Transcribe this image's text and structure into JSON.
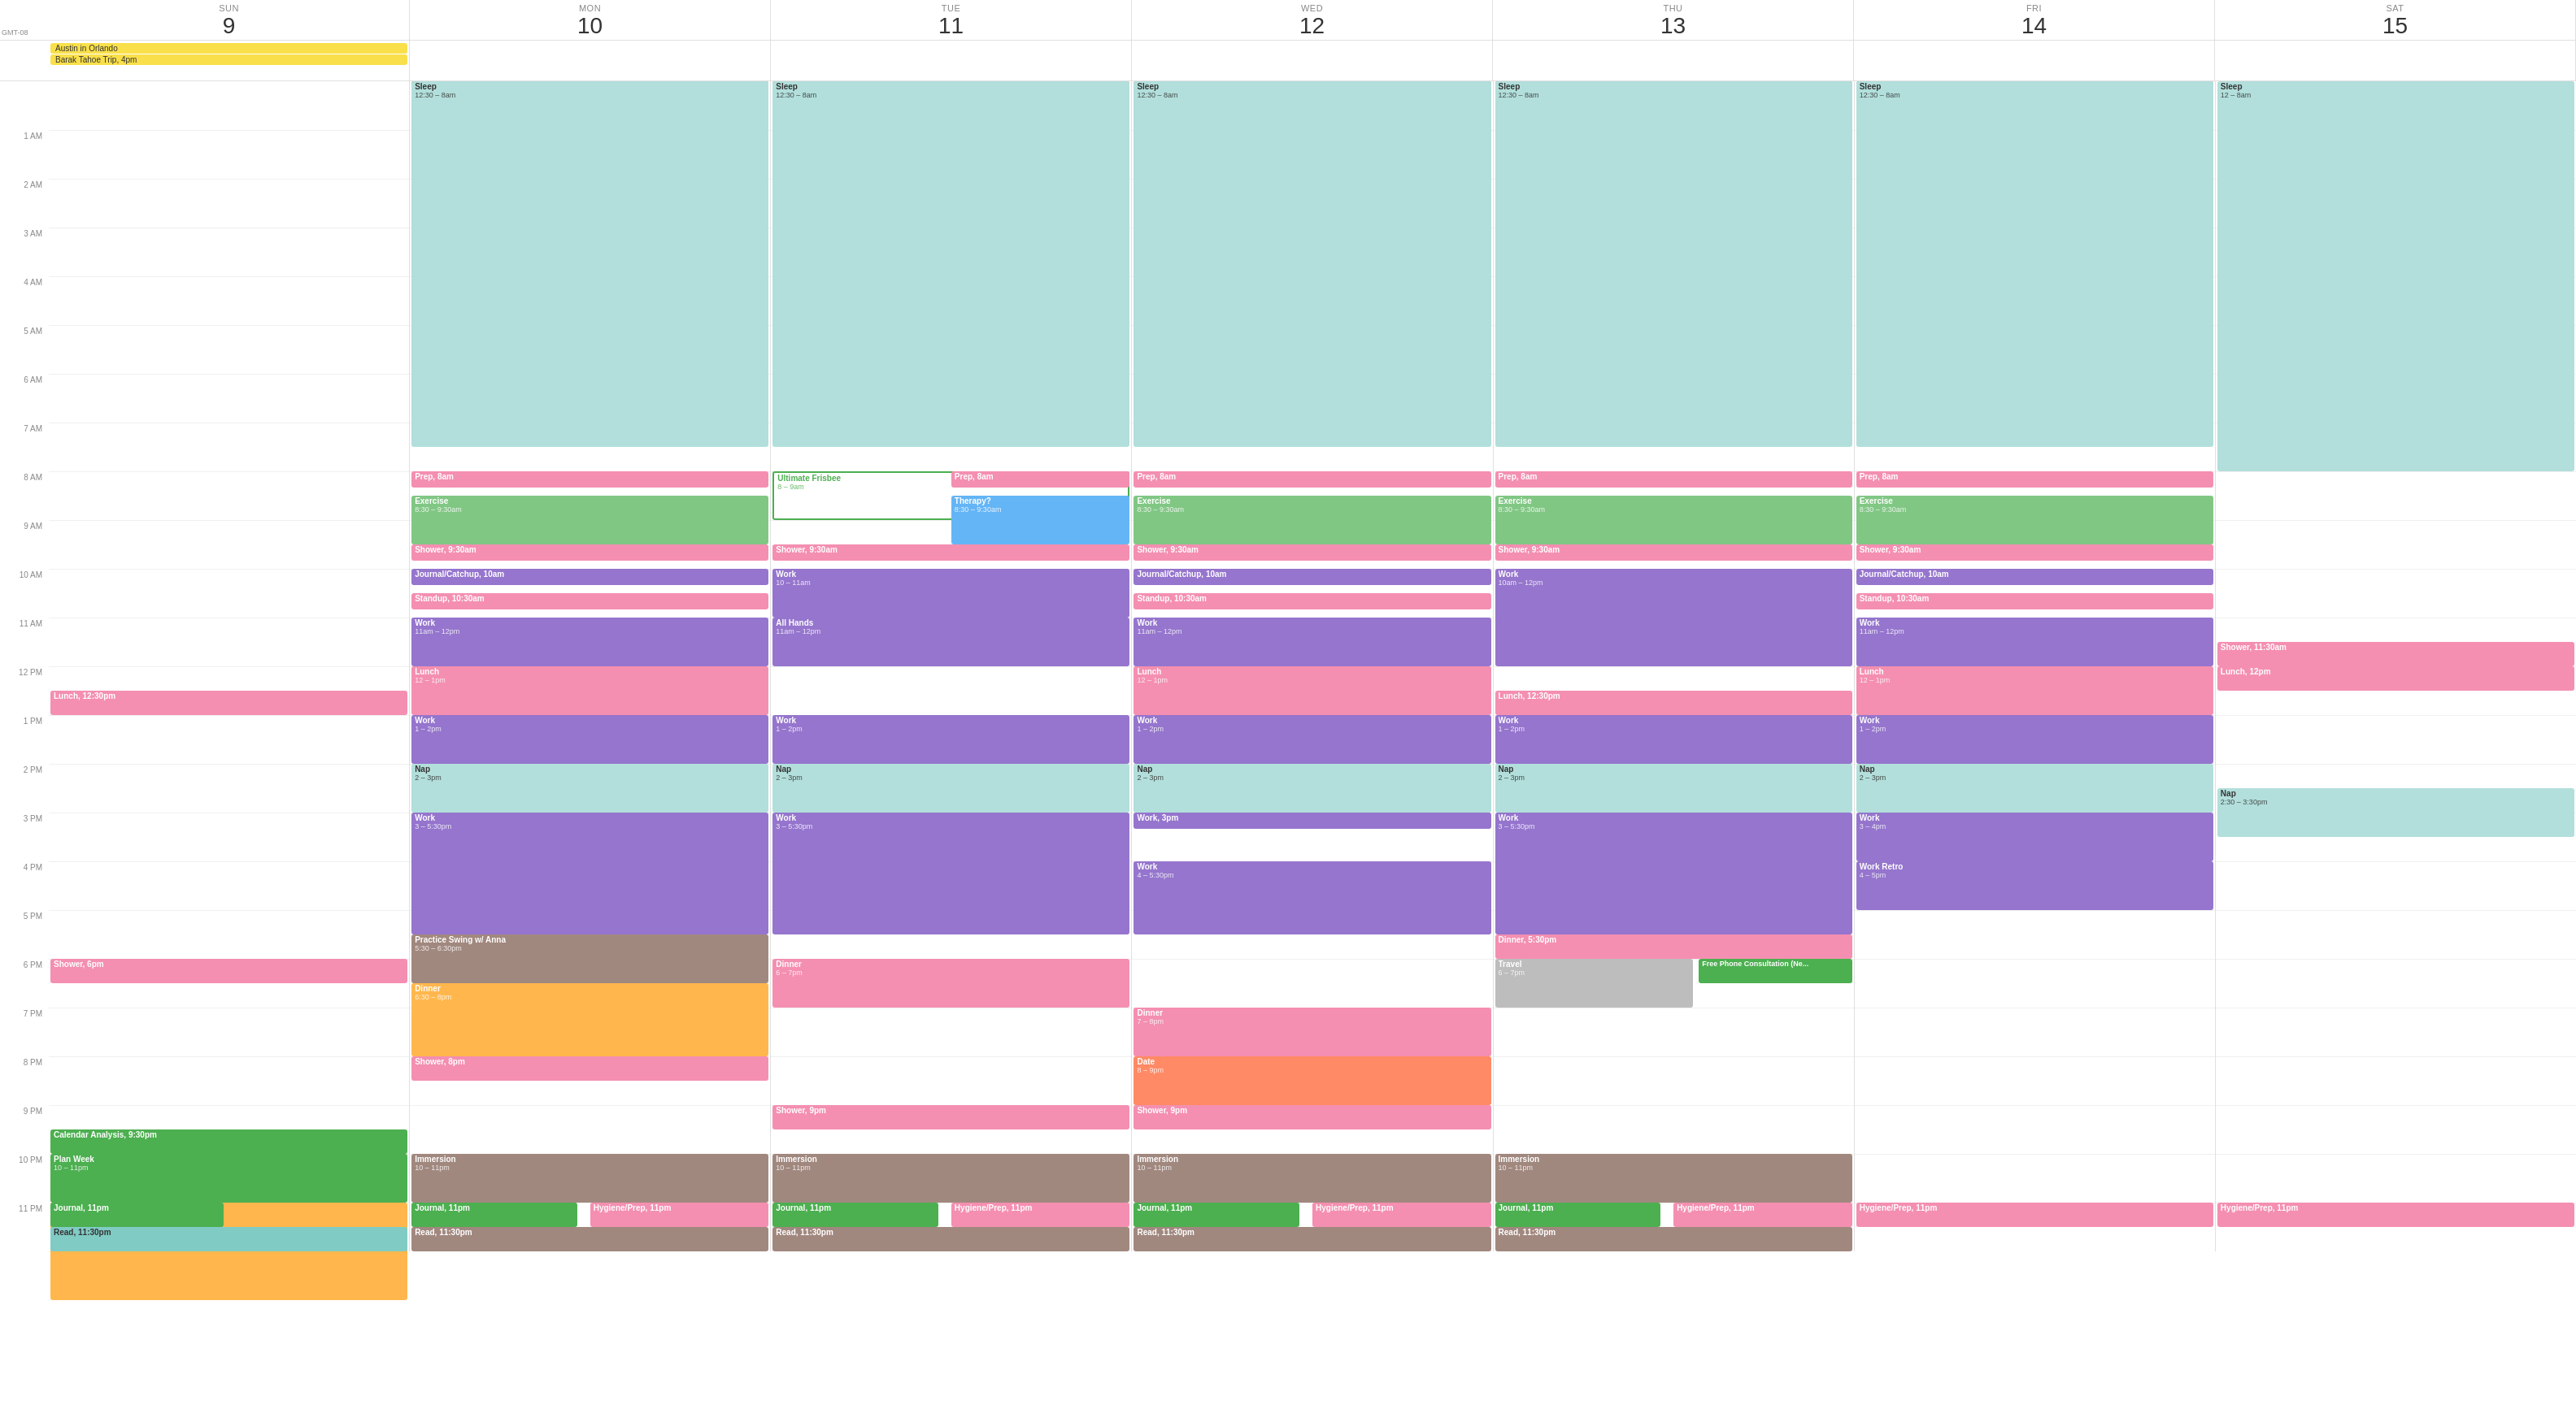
{
  "gmt": "GMT-08",
  "days": [
    {
      "name": "SUN",
      "num": "9"
    },
    {
      "name": "MON",
      "num": "10"
    },
    {
      "name": "TUE",
      "num": "11"
    },
    {
      "name": "WED",
      "num": "12"
    },
    {
      "name": "THU",
      "num": "13"
    },
    {
      "name": "FRI",
      "num": "14"
    },
    {
      "name": "SAT",
      "num": "15"
    }
  ],
  "times": [
    "1 AM",
    "2 AM",
    "3 AM",
    "4 AM",
    "5 AM",
    "6 AM",
    "7 AM",
    "8 AM",
    "9 AM",
    "10 AM",
    "11 AM",
    "12 PM",
    "1 PM",
    "2 PM",
    "3 PM",
    "4 PM",
    "5 PM",
    "6 PM",
    "7 PM",
    "8 PM",
    "9 PM",
    "10 PM",
    "11 PM"
  ],
  "allday_events": {
    "sun": [
      {
        "title": "Austin in Orlando",
        "color": "yellow"
      },
      {
        "title": "Barak Tahoe Trip, 4pm",
        "color": "yellow"
      }
    ],
    "mon": [],
    "tue": [],
    "wed": [],
    "thu": [],
    "fri": [],
    "sat": []
  }
}
